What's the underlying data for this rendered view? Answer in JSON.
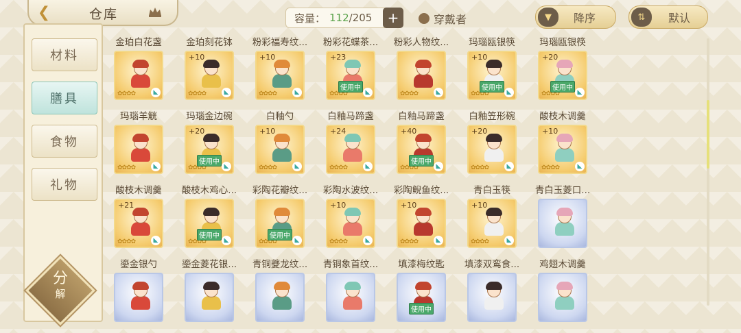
{
  "header": {
    "title": "仓库",
    "capacity_label": "容量：",
    "capacity_current": "112",
    "capacity_total": "/205",
    "wearer_label": "穿戴者",
    "sort_desc_label": "降序",
    "sort_default_label": "默认",
    "sort_desc_icon": "▼",
    "sort_default_icon": "⇅",
    "add_symbol": "+",
    "back_symbol": "❮"
  },
  "nav": {
    "items": [
      {
        "label": "材料"
      },
      {
        "label": "膳具"
      },
      {
        "label": "食物"
      },
      {
        "label": "礼物"
      }
    ],
    "active_index": 1,
    "decompose_top": "分",
    "decompose_bottom": "解"
  },
  "colors": {
    "accent_gold": "#c09138",
    "in_use_green": "#4aa86a",
    "active_tab": "#bfe3dc"
  },
  "grid": {
    "star_glyphs": "✿✿✿✿",
    "in_use_label": "使用中",
    "rows": [
      [
        {
          "name": "金珀白花盏",
          "level": "",
          "in_use": false,
          "theme": "gold"
        },
        {
          "name": "金珀刻花钵",
          "level": "+10",
          "in_use": false,
          "theme": "gold"
        },
        {
          "name": "粉彩福寿纹...",
          "level": "+10",
          "in_use": false,
          "theme": "gold"
        },
        {
          "name": "粉彩花蝶茶...",
          "level": "+23",
          "in_use": true,
          "theme": "gold"
        },
        {
          "name": "粉彩人物纹...",
          "level": "",
          "in_use": false,
          "theme": "gold"
        },
        {
          "name": "玛瑙瓯银筷",
          "level": "+10",
          "in_use": true,
          "theme": "gold"
        },
        {
          "name": "玛瑙瓯银筷",
          "level": "+20",
          "in_use": true,
          "theme": "gold"
        }
      ],
      [
        {
          "name": "玛瑙羊觥",
          "level": "",
          "in_use": false,
          "theme": "gold"
        },
        {
          "name": "玛瑙金边碗",
          "level": "+20",
          "in_use": true,
          "theme": "gold"
        },
        {
          "name": "白釉勺",
          "level": "+10",
          "in_use": false,
          "theme": "gold"
        },
        {
          "name": "白釉马蹄盏",
          "level": "+24",
          "in_use": false,
          "theme": "gold"
        },
        {
          "name": "白釉马蹄盏",
          "level": "+40",
          "in_use": true,
          "theme": "gold"
        },
        {
          "name": "白釉笠形碗",
          "level": "+20",
          "in_use": false,
          "theme": "gold"
        },
        {
          "name": "酸枝木调羹",
          "level": "+10",
          "in_use": false,
          "theme": "gold"
        }
      ],
      [
        {
          "name": "酸枝木调羹",
          "level": "+21",
          "in_use": false,
          "theme": "gold"
        },
        {
          "name": "酸枝木鸡心...",
          "level": "",
          "in_use": true,
          "theme": "gold"
        },
        {
          "name": "彩陶花瓣纹...",
          "level": "",
          "in_use": true,
          "theme": "gold"
        },
        {
          "name": "彩陶水波纹...",
          "level": "+10",
          "in_use": false,
          "theme": "gold"
        },
        {
          "name": "彩陶鲵鱼纹...",
          "level": "+10",
          "in_use": false,
          "theme": "gold"
        },
        {
          "name": "青白玉筷",
          "level": "+10",
          "in_use": false,
          "theme": "gold"
        },
        {
          "name": "青白玉菱口...",
          "level": "",
          "in_use": false,
          "theme": "blue"
        }
      ],
      [
        {
          "name": "鎏金银勺",
          "level": "",
          "in_use": false,
          "theme": "blue"
        },
        {
          "name": "鎏金菱花银...",
          "level": "",
          "in_use": false,
          "theme": "blue"
        },
        {
          "name": "青铜夔龙纹...",
          "level": "",
          "in_use": false,
          "theme": "blue"
        },
        {
          "name": "青铜象首纹...",
          "level": "",
          "in_use": false,
          "theme": "blue"
        },
        {
          "name": "填漆梅纹匙",
          "level": "",
          "in_use": true,
          "theme": "blue"
        },
        {
          "name": "填漆双鸾食...",
          "level": "",
          "in_use": false,
          "theme": "blue"
        },
        {
          "name": "鸡翅木调羹",
          "level": "",
          "in_use": false,
          "theme": "blue"
        }
      ]
    ]
  }
}
